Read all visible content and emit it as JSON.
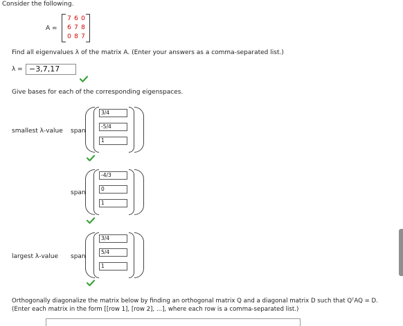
{
  "intro": "Consider the following.",
  "matrix": {
    "label": "A =",
    "rows": [
      [
        "7",
        "6",
        "0"
      ],
      [
        "6",
        "7",
        "8"
      ],
      [
        "0",
        "8",
        "7"
      ]
    ]
  },
  "q1": {
    "prompt": "Find all eigenvalues λ of the matrix A. (Enter your answers as a comma-separated list.)",
    "lambda_label": "λ =",
    "answer": "−3,7,17"
  },
  "q2": {
    "prompt": "Give bases for each of the corresponding eigenspaces.",
    "span_label": "span",
    "eigenspaces": [
      {
        "row_label": "smallest λ-value",
        "vector": [
          "3/4",
          "-5/4",
          "1"
        ]
      },
      {
        "row_label": "",
        "vector": [
          "-4/3",
          "0",
          "1"
        ]
      },
      {
        "row_label": "largest λ-value",
        "vector": [
          "3/4",
          "5/4",
          "1"
        ]
      }
    ]
  },
  "q3": {
    "line1": "Orthogonally diagonalize the matrix below by finding an orthogonal matrix Q and a diagonal matrix D such that QᵀAQ = D.",
    "line2": "(Enter each matrix in the form [[row 1], [row 2], ...], where each row is a comma-separated list.)"
  },
  "colors": {
    "accent_red": "#cc0000",
    "check_green": "#3aa23a"
  }
}
